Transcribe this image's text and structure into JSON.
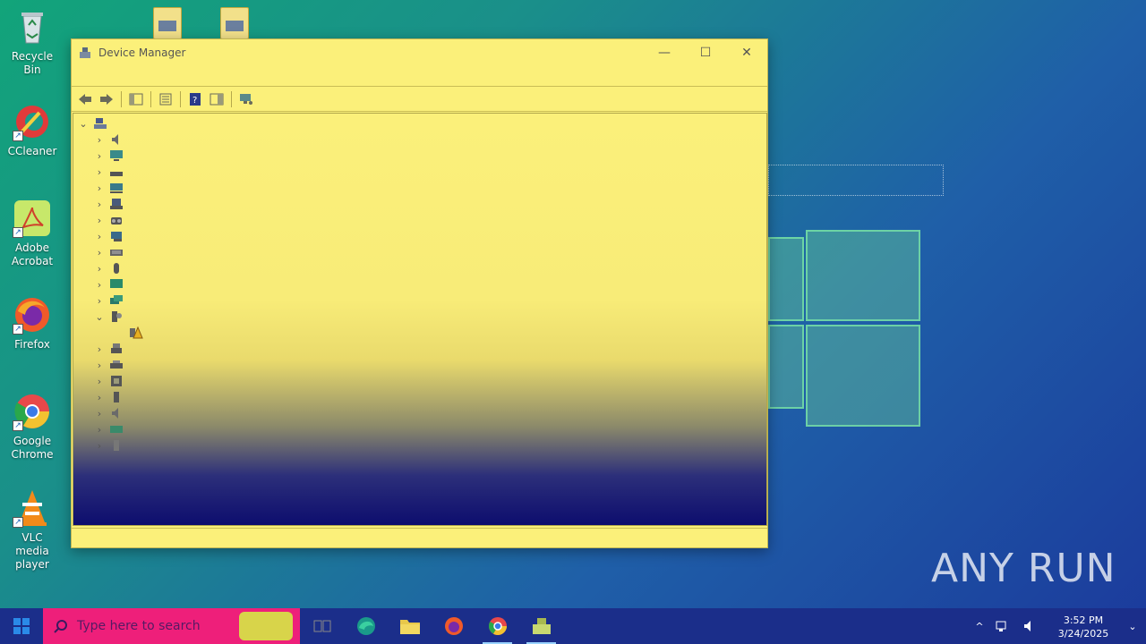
{
  "desktop": {
    "icons": [
      {
        "label": "Recycle Bin"
      },
      {
        "label": "CCleaner"
      },
      {
        "label": "Adobe Acrobat"
      },
      {
        "label": "Firefox"
      },
      {
        "label": "Google Chrome"
      },
      {
        "label": "VLC media player"
      }
    ],
    "watermark": "ANY RUN"
  },
  "window": {
    "title": "Device Manager",
    "controls": {
      "minimize": "—",
      "maximize": "☐",
      "close": "✕"
    }
  },
  "taskbar": {
    "search_placeholder": "Type here to search",
    "clock_time": "3:52 PM",
    "clock_date": "3/24/2025"
  },
  "colors": {
    "window_bg": "#fbf07a",
    "taskbar_bg": "#1b2e8a",
    "search_bg": "#ee1f7a"
  }
}
